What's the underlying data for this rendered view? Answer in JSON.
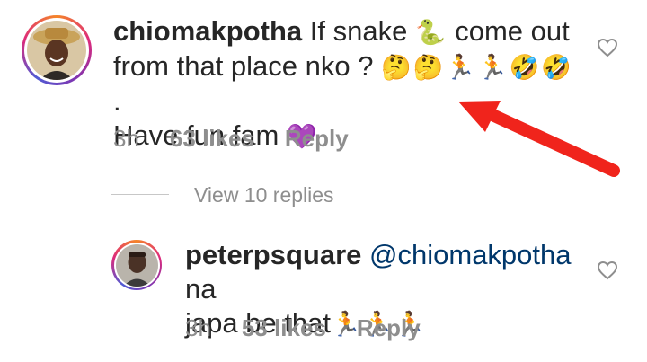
{
  "comment": {
    "username": "chiomakpotha",
    "text_part1": "If snake",
    "emoji_snake": "🐍",
    "text_part2": "come out",
    "text_line2": "from that place nko ?",
    "emojis_line2": "🤔🤔🏃🏃🤣🤣",
    "text_line2_end": ".",
    "text_line3": "Have fun fam",
    "emoji_heart": "💜",
    "time": "3h",
    "likes": "63 likes",
    "reply_label": "Reply"
  },
  "view_replies_label": "View 10 replies",
  "reply": {
    "username": "peterpsquare",
    "mention": "@chiomakpotha",
    "text_part1": "na",
    "text_line2": "japa be that",
    "emojis": "🏃🏃🏃",
    "time": "3h",
    "likes": "53 likes",
    "reply_label": "Reply"
  },
  "colors": {
    "arrow": "#f0241c",
    "text": "#262626",
    "muted": "#8e8e8e",
    "mention": "#00376b"
  },
  "icons": {
    "like": "heart-outline-icon",
    "annotation": "red-arrow-icon"
  }
}
